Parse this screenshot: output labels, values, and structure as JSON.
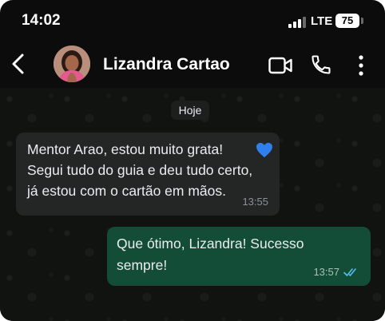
{
  "status_bar": {
    "time": "14:02",
    "network": "LTE",
    "battery": "75"
  },
  "header": {
    "contact_name": "Lizandra Cartao"
  },
  "chat": {
    "date_chip": "Hoje",
    "messages": [
      {
        "direction": "incoming",
        "text": "Mentor Arao, estou muito grata!\nSegui tudo do guia e deu tudo certo,\njá estou com o cartão em mãos.",
        "emoji": "blue-heart-icon",
        "time": "13:55"
      },
      {
        "direction": "outgoing",
        "text": "Que ótimo, Lizandra! Sucesso\nsempre!",
        "time": "13:57",
        "status": "read-double-check"
      }
    ]
  },
  "colors": {
    "outgoing_bubble": "#144d37",
    "incoming_bubble": "#242626",
    "read_ticks": "#53bdeb",
    "heart": "#2f80ed"
  }
}
